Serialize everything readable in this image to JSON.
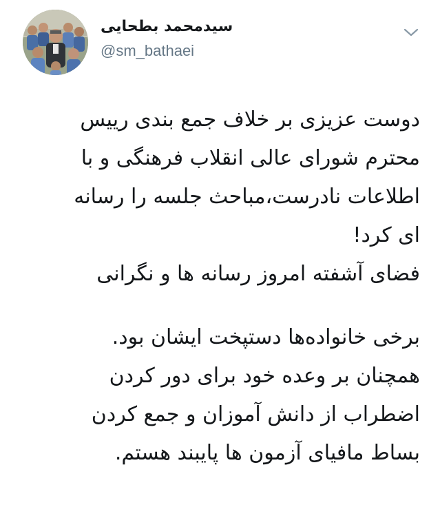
{
  "tweet": {
    "author": {
      "display_name": "سیدمحمد بطحایی",
      "handle": "@sm_bathaei",
      "avatar_icon": "profile-photo-group-icon"
    },
    "menu_icon": "chevron-down-icon",
    "text_lines": [
      "دوست عزیزی بر خلاف جمع بندی رییس",
      "محترم شورای عالی انقلاب فرهنگی و با",
      "اطلاعات نادرست،مباحث جلسه را رسانه",
      "ای کرد!",
      "فضای آشفته امروز رسانه ها و نگرانی",
      "برخی خانواده‌ها دستپخت ایشان بود.",
      "همچنان بر وعده خود برای دور کردن",
      "اضطراب از دانش آموزان و جمع کردن",
      "بساط مافیای آزمون ها پایبند هستم."
    ]
  },
  "colors": {
    "text": "#14171a",
    "secondary": "#657786",
    "background": "#ffffff"
  }
}
